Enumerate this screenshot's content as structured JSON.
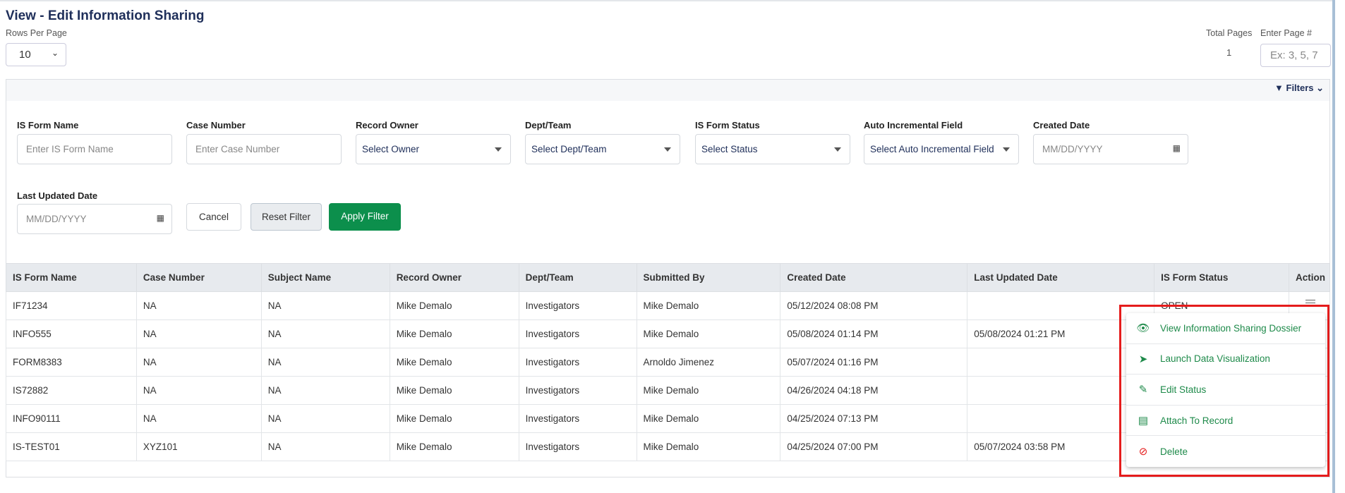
{
  "page": {
    "title": "View - Edit Information Sharing"
  },
  "pagination": {
    "rows_per_page_label": "Rows Per Page",
    "rows_per_page_value": "10",
    "total_pages_label": "Total Pages",
    "total_pages_value": "1",
    "enter_page_label": "Enter Page #",
    "enter_page_placeholder": "Ex: 3, 5, 7"
  },
  "filters": {
    "toggle_label": "Filters",
    "fields": [
      {
        "label": "IS Form Name",
        "placeholder": "Enter IS Form Name"
      },
      {
        "label": "Case Number",
        "placeholder": "Enter Case Number"
      },
      {
        "label": "Record Owner",
        "value": "Select Owner"
      },
      {
        "label": "Dept/Team",
        "value": "Select Dept/Team"
      },
      {
        "label": "IS Form Status",
        "value": "Select Status"
      },
      {
        "label": "Auto Incremental Field",
        "value": "Select Auto Incremental Field"
      },
      {
        "label": "Created Date",
        "placeholder": "MM/DD/YYYY"
      },
      {
        "label": "Last Updated Date",
        "placeholder": "MM/DD/YYYY"
      }
    ],
    "cancel": "Cancel",
    "reset": "Reset Filter",
    "apply": "Apply Filter"
  },
  "table": {
    "columns": [
      "IS Form Name",
      "Case Number",
      "Subject Name",
      "Record Owner",
      "Dept/Team",
      "Submitted By",
      "Created Date",
      "Last Updated Date",
      "IS Form Status",
      "Action"
    ],
    "rows": [
      [
        "IF71234",
        "NA",
        "NA",
        "Mike Demalo",
        "Investigators",
        "Mike Demalo",
        "05/12/2024 08:08 PM",
        "",
        "OPEN",
        ""
      ],
      [
        "INFO555",
        "NA",
        "NA",
        "Mike Demalo",
        "Investigators",
        "Mike Demalo",
        "05/08/2024 01:14 PM",
        "05/08/2024 01:21 PM",
        "",
        ""
      ],
      [
        "FORM8383",
        "NA",
        "NA",
        "Mike Demalo",
        "Investigators",
        "Arnoldo Jimenez",
        "05/07/2024 01:16 PM",
        "",
        "",
        ""
      ],
      [
        "IS72882",
        "NA",
        "NA",
        "Mike Demalo",
        "Investigators",
        "Mike Demalo",
        "04/26/2024 04:18 PM",
        "",
        "",
        ""
      ],
      [
        "INFO90111",
        "NA",
        "NA",
        "Mike Demalo",
        "Investigators",
        "Mike Demalo",
        "04/25/2024 07:13 PM",
        "",
        "",
        ""
      ],
      [
        "IS-TEST01",
        "XYZ101",
        "NA",
        "Mike Demalo",
        "Investigators",
        "Mike Demalo",
        "04/25/2024 07:00 PM",
        "05/07/2024 03:58 PM",
        "",
        ""
      ]
    ]
  },
  "action_menu": {
    "items": [
      {
        "label": "View Information Sharing Dossier",
        "icon": "eye-icon"
      },
      {
        "label": "Launch Data Visualization",
        "icon": "rocket-icon"
      },
      {
        "label": "Edit Status",
        "icon": "edit-comment-icon"
      },
      {
        "label": "Attach To Record",
        "icon": "archive-box-icon"
      },
      {
        "label": "Delete",
        "icon": "ban-icon"
      }
    ],
    "colors": {
      "text": "#1e8a4a",
      "delete_icon": "#e51c1c",
      "highlight": "#e51c1c"
    }
  }
}
